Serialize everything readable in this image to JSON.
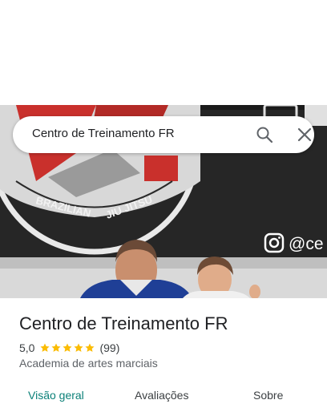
{
  "search": {
    "query": "Centro de Treinamento FR"
  },
  "photo": {
    "logo_text": "BRAZILIAN JIU JITSU",
    "handle_text": "@ce"
  },
  "place": {
    "name": "Centro de Treinamento FR",
    "rating": "5,0",
    "stars": 5,
    "review_count": "(99)",
    "category": "Academia de artes marciais"
  },
  "tabs": [
    {
      "label": "Visão geral",
      "active": true
    },
    {
      "label": "Avaliações",
      "active": false
    },
    {
      "label": "Sobre",
      "active": false
    }
  ],
  "colors": {
    "accent": "#0b8078",
    "star": "#fbbc04",
    "text_primary": "#202124",
    "text_secondary": "#5f6368"
  },
  "icons": [
    "search-icon",
    "close-icon",
    "star-icon",
    "instagram-icon"
  ]
}
